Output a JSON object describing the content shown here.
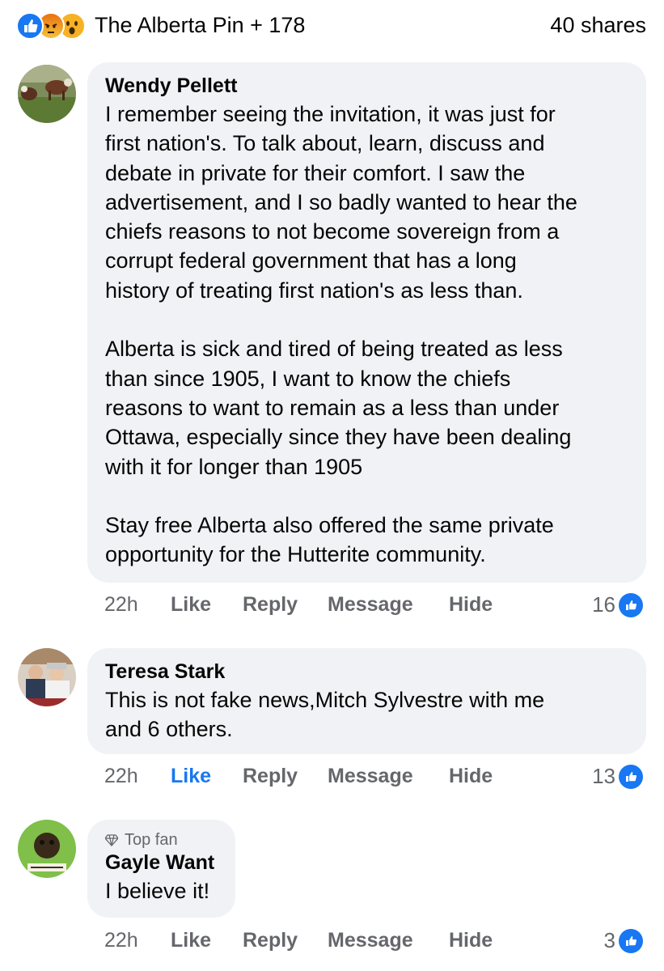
{
  "header": {
    "reaction_icons": [
      "like-icon",
      "angry-icon",
      "wow-icon"
    ],
    "reaction_names": "The Alberta Pin + 178",
    "shares": "40 shares"
  },
  "comments": [
    {
      "author": "Wendy Pellett",
      "badge": "",
      "text": "I remember seeing the invitation, it was just for\nfirst nation's.  To talk about, learn, discuss and\ndebate in private for their comfort.  I saw the\nadvertisement,  and I so badly wanted to hear the\nchiefs reasons to not become sovereign from a\ncorrupt federal government that has a long\nhistory of treating first nation's as less than.\n\nAlberta is sick and tired of being treated as less\nthan since 1905, I want to know the chiefs\nreasons to want to remain as a less than under\nOttawa, especially since they have been dealing\nwith it for longer than 1905\n\nStay free Alberta also offered the same private\nopportunity for the Hutterite community.",
      "time": "22h",
      "like": "Like",
      "reply": "Reply",
      "message": "Message",
      "hide": "Hide",
      "reactions": "16"
    },
    {
      "author": "Teresa Stark",
      "badge": "",
      "text": "This is not fake news,Mitch Sylvestre with me\nand 6 others.",
      "time": "22h",
      "like": "Like",
      "reply": "Reply",
      "message": "Message",
      "hide": "Hide",
      "reactions": "13"
    },
    {
      "author": "Gayle Want",
      "badge": "Top fan",
      "text": "I believe it!",
      "time": "22h",
      "like": "Like",
      "reply": "Reply",
      "message": "Message",
      "hide": "Hide",
      "reactions": "3"
    }
  ],
  "colors": {
    "accent": "#1877f2",
    "bubble": "#f0f2f5",
    "muted": "#65676b"
  }
}
